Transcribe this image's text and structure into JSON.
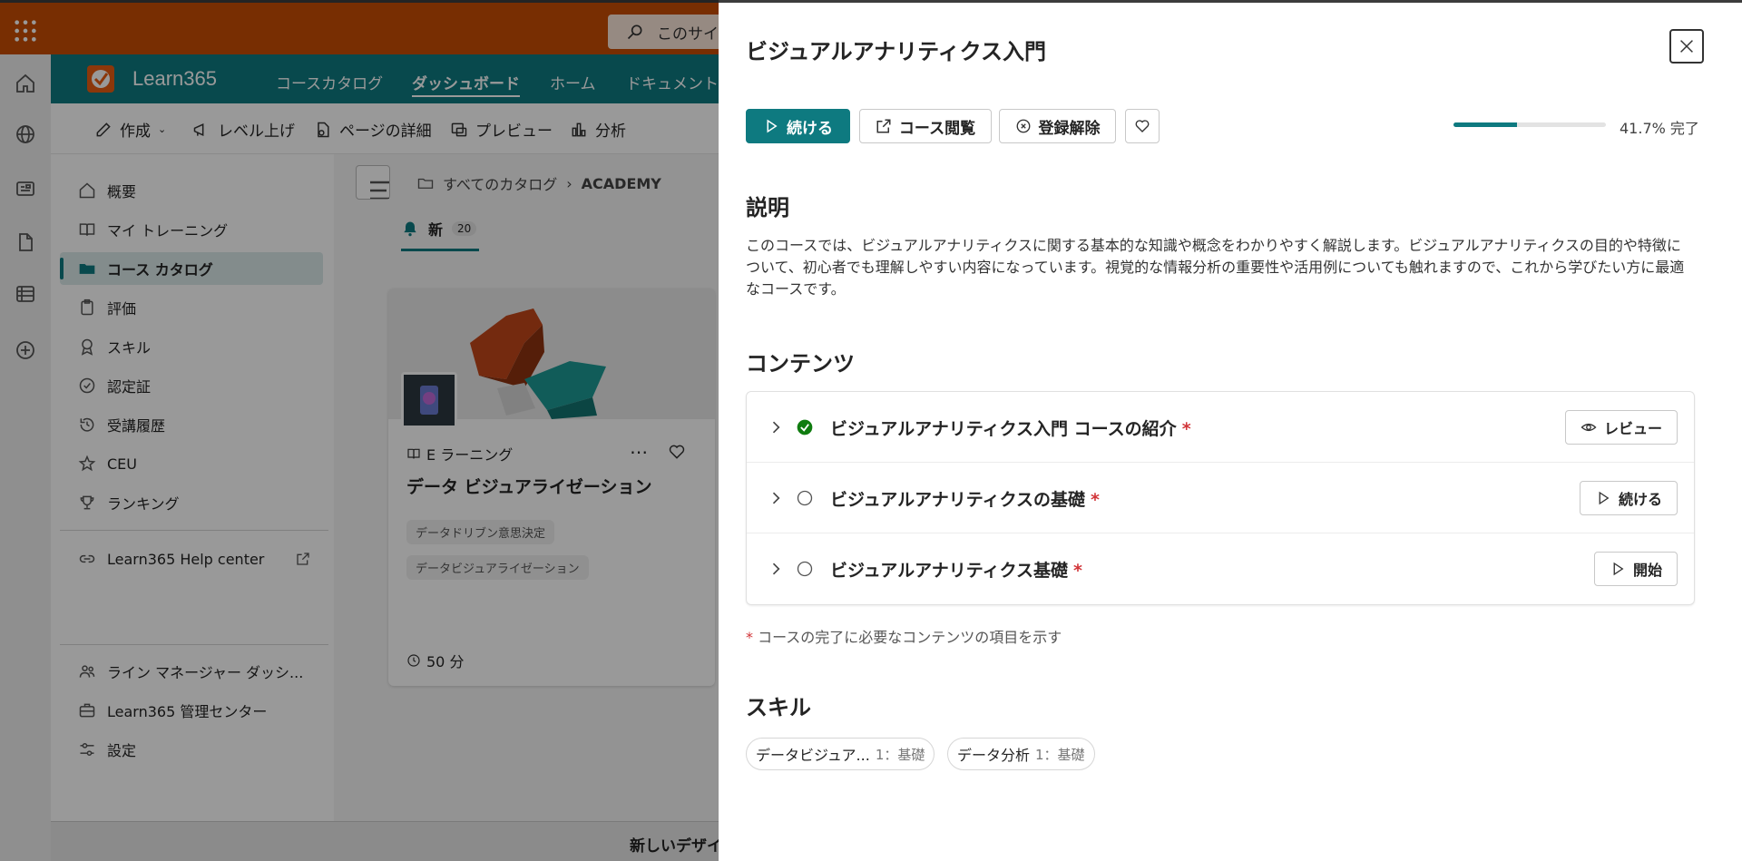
{
  "search": {
    "placeholder": "このサイ"
  },
  "site": {
    "name": "Learn365"
  },
  "topnav": [
    {
      "label": "コースカタログ"
    },
    {
      "label": "ダッシュボード"
    },
    {
      "label": "ホーム"
    },
    {
      "label": "ドキュメント"
    }
  ],
  "commands": {
    "create": "作成",
    "level_up": "レベル上げ",
    "page_details": "ページの詳細",
    "preview": "プレビュー",
    "analytics": "分析"
  },
  "leftnav": {
    "items": [
      {
        "label": "概要"
      },
      {
        "label": "マイ トレーニング"
      },
      {
        "label": "コース カタログ"
      },
      {
        "label": "評価"
      },
      {
        "label": "スキル"
      },
      {
        "label": "認定証"
      },
      {
        "label": "受講履歴"
      },
      {
        "label": "CEU"
      },
      {
        "label": "ランキング"
      }
    ],
    "help": "Learn365 Help center",
    "bottom": [
      {
        "label": "ライン マネージャー ダッシ..."
      },
      {
        "label": "Learn365 管理センター"
      },
      {
        "label": "設定"
      }
    ]
  },
  "breadcrumb": {
    "root": "すべてのカタログ",
    "current": "ACADEMY"
  },
  "feed_tab": {
    "label": "新",
    "count": "20"
  },
  "course_card": {
    "type": "E ラーニング",
    "title": "データ ビジュアライゼーション",
    "tags": [
      "データドリブン意思決定",
      "データビジュアライゼーション"
    ],
    "duration": "50 分"
  },
  "banner": {
    "text": "新しいデザイ"
  },
  "panel": {
    "title": "ビジュアルアナリティクス入門",
    "actions": {
      "continue": "続ける",
      "browse": "コース閲覧",
      "unenroll": "登録解除"
    },
    "progress": {
      "percent": 41.7,
      "label": "41.7% 完了"
    },
    "description_title": "説明",
    "description": "このコースでは、ビジュアルアナリティクスに関する基本的な知識や概念をわかりやすく解説します。ビジュアルアナリティクスの目的や特徴について、初心者でも理解しやすい内容になっています。視覚的な情報分析の重要性や活用例についても触れますので、これから学びたい方に最適なコースです。",
    "contents_title": "コンテンツ",
    "contents": [
      {
        "title": "ビジュアルアナリティクス入門 コースの紹介",
        "required": "*",
        "status": "completed",
        "action": "レビュー"
      },
      {
        "title": "ビジュアルアナリティクスの基礎",
        "required": "*",
        "status": "not-started",
        "action": "続ける"
      },
      {
        "title": "ビジュアルアナリティクス基礎",
        "required": "*",
        "status": "not-started",
        "action": "開始"
      }
    ],
    "footnote_mark": "*",
    "footnote": "コースの完了に必要なコンテンツの項目を示す",
    "skills_title": "スキル",
    "skills": [
      {
        "name": "データビジュア...",
        "level": "1：基礎"
      },
      {
        "name": "データ分析",
        "level": "1：基礎"
      }
    ]
  },
  "colors": {
    "accent": "#0e7a80",
    "brand": "#c84e04",
    "required": "#d13438",
    "complete": "#107c10"
  }
}
